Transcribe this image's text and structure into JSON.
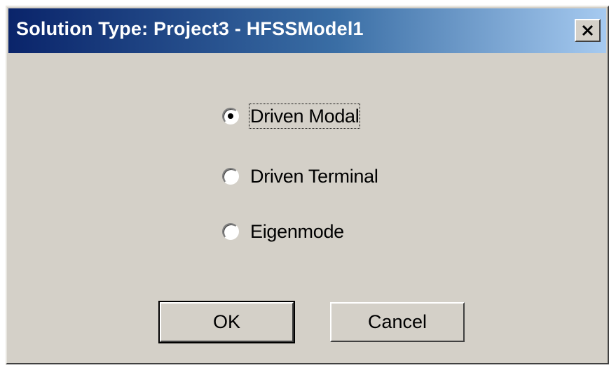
{
  "window": {
    "title": "Solution Type: Project3 - HFSSModel1",
    "close_icon": "close-icon"
  },
  "solution_types": [
    {
      "label": "Driven Modal",
      "selected": true
    },
    {
      "label": "Driven Terminal",
      "selected": false
    },
    {
      "label": "Eigenmode",
      "selected": false
    }
  ],
  "buttons": {
    "ok_label": "OK",
    "cancel_label": "Cancel"
  }
}
